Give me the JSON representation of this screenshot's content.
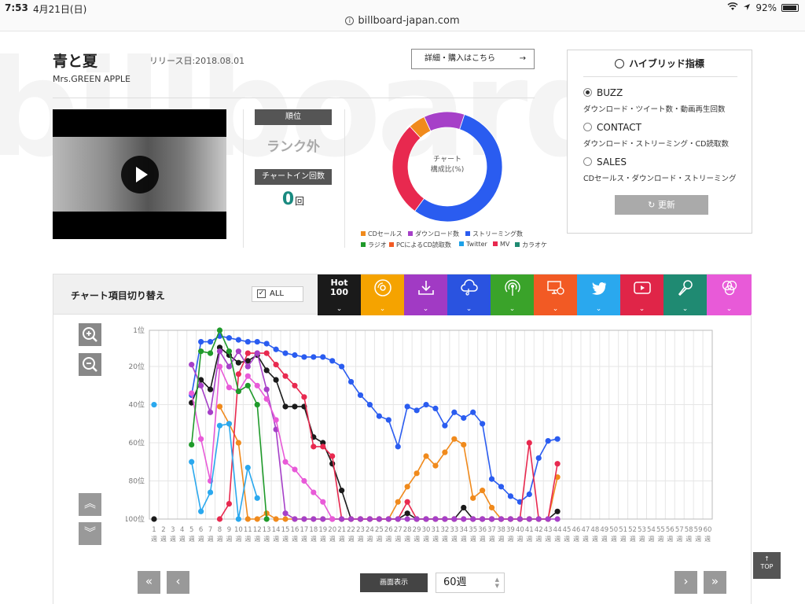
{
  "status_bar": {
    "time": "7:53",
    "date": "4月21日(日)",
    "battery": "92%"
  },
  "browser": {
    "url": "billboard-japan.com"
  },
  "song": {
    "title": "青と夏",
    "release_date": "リリース日:2018.08.01",
    "artist": "Mrs.GREEN APPLE",
    "buy_label": "詳細・購入はこちら",
    "buy_arrow": "→"
  },
  "rank": {
    "label": "順位",
    "value": "ランク外",
    "chart_in_label": "チャートイン回数",
    "chart_in_count": "0",
    "chart_in_unit": "回"
  },
  "composition": {
    "center_line1": "チャート",
    "center_line2": "構成比(%)",
    "segments": [
      {
        "name": "CDセールス",
        "value": 5,
        "color": "#f08a1c"
      },
      {
        "name": "ダウンロード数",
        "value": 12,
        "color": "#a640c8"
      },
      {
        "name": "ストリーミング数",
        "value": 55,
        "color": "#2a5cf0"
      },
      {
        "name": "MV",
        "value": 28,
        "color": "#e8294f"
      }
    ],
    "legend": [
      {
        "label": "CDセールス",
        "color": "#f08a1c"
      },
      {
        "label": "ダウンロード数",
        "color": "#a640c8"
      },
      {
        "label": "ストリーミング数",
        "color": "#2a5cf0"
      },
      {
        "label": "ラジオ",
        "color": "#1f9a2a"
      },
      {
        "label": "PCによるCD読取数",
        "color": "#f25a24"
      },
      {
        "label": "Twitter",
        "color": "#1da1e8"
      },
      {
        "label": "MV",
        "color": "#e8294f"
      },
      {
        "label": "カラオケ",
        "color": "#1f8a72"
      }
    ]
  },
  "hybrid": {
    "title": "ハイブリッド指標",
    "options": [
      {
        "label": "BUZZ",
        "desc": "ダウンロード・ツイート数・動画再生回数",
        "selected": true
      },
      {
        "label": "CONTACT",
        "desc": "ダウンロード・ストリーミング・CD読取数",
        "selected": false
      },
      {
        "label": "SALES",
        "desc": "CDセールス・ダウンロード・ストリーミング",
        "selected": false
      }
    ],
    "update_label": "更新"
  },
  "chart_toggle": {
    "title": "チャート項目切り替え",
    "all_label": "ALL",
    "all_check": "✓",
    "hot_line1": "Hot",
    "hot_line2": "100",
    "chevron": "⌄",
    "categories": [
      {
        "key": "hot",
        "color": "#1a1a1a"
      },
      {
        "key": "cd",
        "color": "#f5a300"
      },
      {
        "key": "download",
        "color": "#a13ac4"
      },
      {
        "key": "streaming",
        "color": "#2a53e0"
      },
      {
        "key": "radio",
        "color": "#3aa32a"
      },
      {
        "key": "pc-read",
        "color": "#f25a24"
      },
      {
        "key": "twitter",
        "color": "#2aa8ee"
      },
      {
        "key": "mv",
        "color": "#e02548"
      },
      {
        "key": "karaoke",
        "color": "#1f8a72"
      },
      {
        "key": "hybrid",
        "color": "#e85ad8"
      }
    ]
  },
  "controls": {
    "view_label": "画面表示",
    "view_value": "60週",
    "top_label": "TOP",
    "top_arrow": "↑",
    "nav_first": "«",
    "nav_prev": "‹",
    "nav_next": "›",
    "nav_last": "»",
    "scroll_up": "︽",
    "scroll_down": "︾"
  },
  "chart_data": {
    "type": "line",
    "y_axis": {
      "ticks": [
        "1位",
        "20位",
        "40位",
        "60位",
        "80位",
        "100位"
      ],
      "min": 1,
      "max": 100,
      "reversed": true
    },
    "x_axis": {
      "weeks": 60,
      "unit": "週"
    },
    "series": [
      {
        "color": "#1a1a1a",
        "x": [
          1,
          5,
          6,
          7,
          8,
          9,
          10,
          11,
          12,
          13,
          14,
          15,
          16,
          17,
          18,
          19,
          20,
          21,
          22,
          23,
          24,
          25,
          26,
          27,
          28,
          29,
          30,
          31,
          32,
          33,
          34,
          35,
          36,
          37,
          38,
          39,
          40,
          41,
          42,
          43,
          44
        ],
        "y": [
          100,
          39,
          27,
          32,
          10,
          14,
          18,
          17,
          14,
          22,
          27,
          41,
          41,
          41,
          57,
          60,
          71,
          85,
          100,
          100,
          100,
          100,
          100,
          100,
          97,
          100,
          100,
          100,
          100,
          100,
          94,
          100,
          100,
          100,
          100,
          100,
          100,
          100,
          100,
          100,
          96
        ]
      },
      {
        "color": "#2a5cf0",
        "x": [
          5,
          6,
          7,
          8,
          9,
          10,
          11,
          12,
          13,
          14,
          15,
          16,
          17,
          18,
          19,
          20,
          21,
          22,
          23,
          24,
          25,
          26,
          27,
          28,
          29,
          30,
          31,
          32,
          33,
          34,
          35,
          36,
          37,
          38,
          39,
          40,
          41,
          42,
          43,
          44
        ],
        "y": [
          35,
          7,
          7,
          4,
          5,
          6,
          7,
          7,
          8,
          11,
          13,
          14,
          15,
          15,
          15,
          17,
          20,
          28,
          35,
          40,
          46,
          48,
          62,
          41,
          43,
          40,
          42,
          51,
          44,
          47,
          44,
          50,
          79,
          83,
          88,
          91,
          87,
          68,
          59,
          58
        ]
      },
      {
        "color": "#f08a1c",
        "x": [
          8,
          9,
          10,
          11,
          12,
          13,
          14,
          15,
          16,
          17,
          18,
          19,
          20,
          21,
          22,
          23,
          24,
          25,
          26,
          27,
          28,
          29,
          30,
          31,
          32,
          33,
          34,
          35,
          36,
          37,
          38,
          39,
          40,
          41,
          42,
          43,
          44
        ],
        "y": [
          41,
          50,
          60,
          100,
          100,
          97,
          100,
          100,
          100,
          100,
          100,
          100,
          100,
          100,
          100,
          100,
          100,
          100,
          100,
          91,
          83,
          76,
          67,
          72,
          65,
          58,
          61,
          89,
          85,
          94,
          100,
          100,
          100,
          100,
          100,
          100,
          78
        ]
      },
      {
        "color": "#e8294f",
        "x": [
          8,
          9,
          10,
          11,
          12,
          13,
          14,
          15,
          16,
          17,
          18,
          19,
          20,
          21,
          22,
          23,
          24,
          25,
          26,
          27,
          28,
          29,
          30,
          31,
          32,
          33,
          34,
          35,
          36,
          37,
          38,
          39,
          40,
          41,
          42,
          43,
          44
        ],
        "y": [
          100,
          92,
          24,
          13,
          13,
          13,
          19,
          25,
          30,
          36,
          62,
          62,
          67,
          100,
          100,
          100,
          100,
          100,
          100,
          100,
          91,
          100,
          100,
          100,
          100,
          100,
          100,
          100,
          100,
          100,
          100,
          100,
          100,
          60,
          100,
          100,
          71
        ]
      },
      {
        "color": "#a640c8",
        "x": [
          5,
          6,
          7,
          8,
          9,
          10,
          11,
          12,
          13,
          14,
          15,
          16,
          17,
          18,
          19,
          20,
          21,
          22,
          23,
          24,
          25,
          26,
          27,
          28,
          29,
          30,
          31,
          32,
          33,
          34,
          35,
          36,
          37,
          38,
          39,
          40,
          41,
          42,
          43,
          44
        ],
        "y": [
          19,
          30,
          44,
          12,
          20,
          12,
          20,
          13,
          32,
          53,
          97,
          100,
          100,
          100,
          100,
          100,
          100,
          100,
          100,
          100,
          100,
          100,
          100,
          100,
          100,
          100,
          100,
          100,
          100,
          100,
          100,
          100,
          100,
          100,
          100,
          100,
          100,
          100,
          100,
          100
        ]
      },
      {
        "color": "#e85ad8",
        "x": [
          5,
          6,
          7,
          8,
          9,
          10,
          11,
          12,
          13,
          14,
          15,
          16,
          17,
          18,
          19,
          20
        ],
        "y": [
          34,
          58,
          80,
          20,
          31,
          33,
          25,
          30,
          37,
          48,
          70,
          74,
          80,
          86,
          91,
          100
        ]
      },
      {
        "color": "#2aa8ee",
        "x": [
          1,
          5,
          6,
          7,
          8,
          9,
          10,
          11,
          12
        ],
        "y": [
          40,
          70,
          96,
          86,
          51,
          50,
          100,
          73,
          89
        ]
      },
      {
        "color": "#1f9a2a",
        "x": [
          5,
          6,
          7,
          8,
          9,
          10,
          11,
          12,
          13
        ],
        "y": [
          61,
          12,
          13,
          1,
          12,
          33,
          30,
          40,
          100
        ]
      }
    ]
  }
}
